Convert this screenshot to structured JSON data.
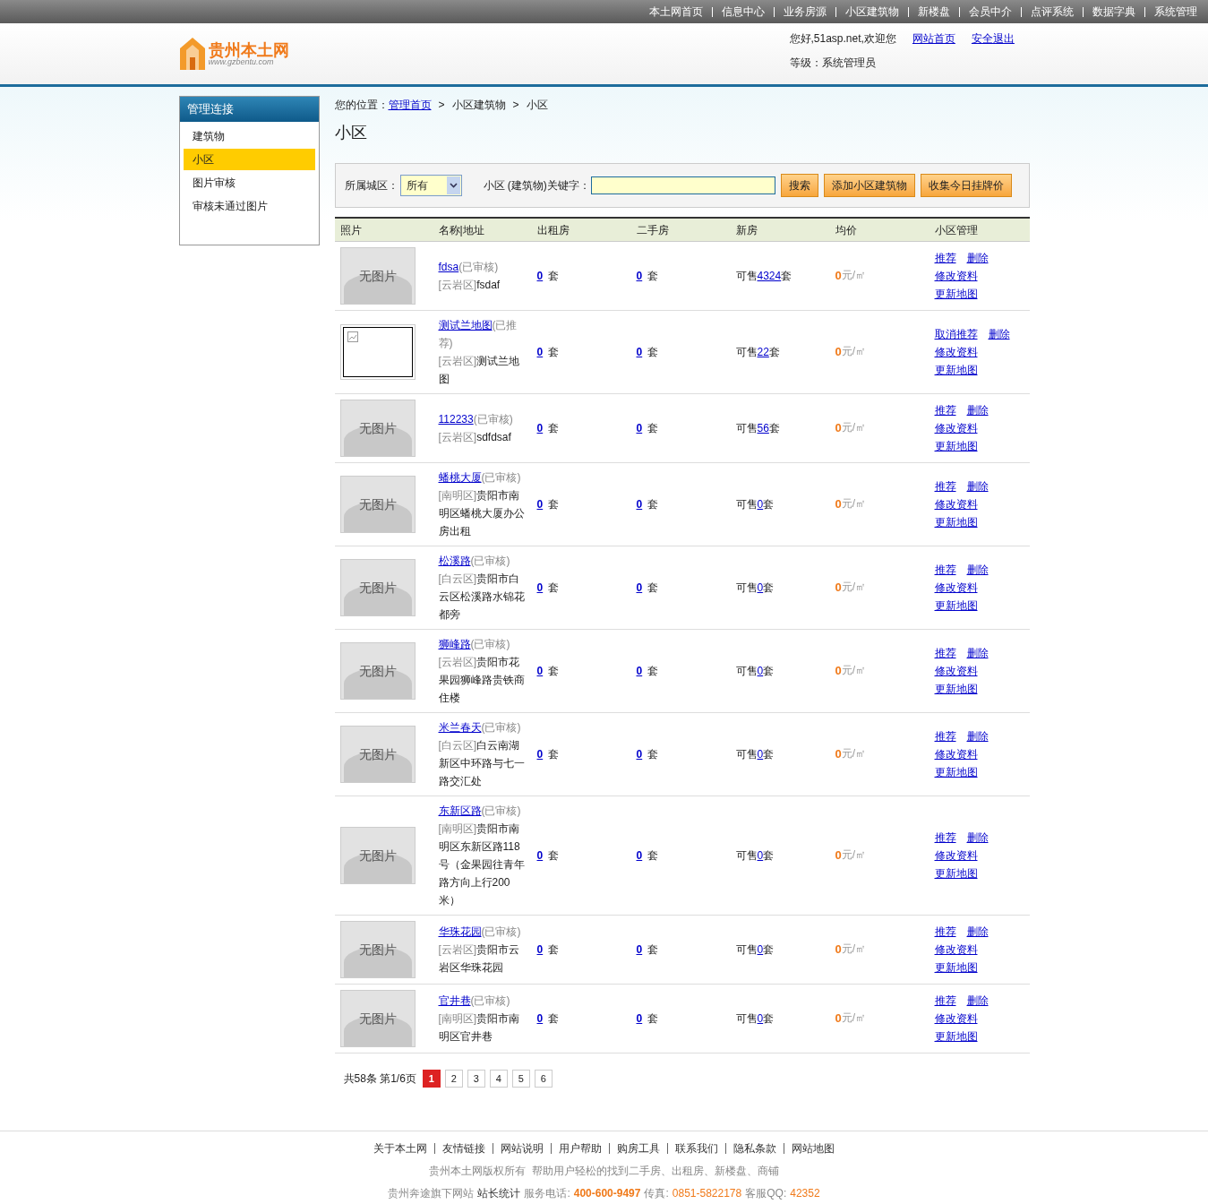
{
  "top_nav": [
    "本土网首页",
    "信息中心",
    "业务房源",
    "小区建筑物",
    "新楼盘",
    "会员中介",
    "点评系统",
    "数据字典",
    "系统管理"
  ],
  "logo": {
    "title": "贵州本土网",
    "url": "www.gzbentu.com"
  },
  "user": {
    "greeting": "您好,51asp.net,欢迎您",
    "links": [
      "网站首页",
      "安全退出"
    ],
    "level": "等级：系统管理员"
  },
  "sidebar": {
    "title": "管理连接",
    "items": [
      {
        "label": "建筑物",
        "selected": false
      },
      {
        "label": "小区",
        "selected": true
      },
      {
        "label": "图片审核",
        "selected": false
      },
      {
        "label": "审核未通过图片",
        "selected": false
      }
    ]
  },
  "breadcrumb": {
    "prefix": "您的位置：",
    "home": "管理首页",
    "sep": ">",
    "items": [
      "小区建筑物",
      "小区"
    ]
  },
  "page_title": "小区",
  "filter": {
    "district_label": "所属城区：",
    "district_value": "所有",
    "keyword_label": "小区 (建筑物)关键字：",
    "buttons": [
      "搜索",
      "添加小区建筑物",
      "收集今日挂牌价"
    ]
  },
  "table": {
    "columns": [
      "照片",
      "名称|地址",
      "出租房",
      "二手房",
      "新房",
      "均价",
      "小区管理"
    ],
    "rows": [
      {
        "photo": {
          "kind": "placeholder",
          "text": "无图片"
        },
        "name": "fdsa",
        "status": "(已审核)",
        "district": "[云岩区]",
        "address": "fsdaf",
        "rent": "0",
        "rent_unit": "套",
        "second": "0",
        "second_unit": "套",
        "sale_prefix": "可售",
        "new": "4324",
        "new_unit": "套",
        "price": "0",
        "price_unit": "元/㎡",
        "actions": [
          [
            "推荐",
            "删除"
          ],
          [
            "修改资料"
          ],
          [
            "更新地图"
          ]
        ]
      },
      {
        "photo": {
          "kind": "broken"
        },
        "name": "测试兰地图",
        "status": "(已推荐)",
        "district": "[云岩区]",
        "address": "测试兰地图",
        "rent": "0",
        "rent_unit": "套",
        "second": "0",
        "second_unit": "套",
        "sale_prefix": "可售",
        "new": "22",
        "new_unit": "套",
        "price": "0",
        "price_unit": "元/㎡",
        "actions": [
          [
            "取消推荐",
            "删除"
          ],
          [
            "修改资料"
          ],
          [
            "更新地图"
          ]
        ]
      },
      {
        "photo": {
          "kind": "placeholder",
          "text": "无图片"
        },
        "name": "112233",
        "status": "(已审核)",
        "district": "[云岩区]",
        "address": "sdfdsaf",
        "rent": "0",
        "rent_unit": "套",
        "second": "0",
        "second_unit": "套",
        "sale_prefix": "可售",
        "new": "56",
        "new_unit": "套",
        "price": "0",
        "price_unit": "元/㎡",
        "actions": [
          [
            "推荐",
            "删除"
          ],
          [
            "修改资料"
          ],
          [
            "更新地图"
          ]
        ]
      },
      {
        "photo": {
          "kind": "placeholder",
          "text": "无图片"
        },
        "name": "蟠桃大厦",
        "status": "(已审核)",
        "district": "[南明区]",
        "address": "贵阳市南明区蟠桃大厦办公房出租",
        "rent": "0",
        "rent_unit": "套",
        "second": "0",
        "second_unit": "套",
        "sale_prefix": "可售",
        "new": "0",
        "new_unit": "套",
        "price": "0",
        "price_unit": "元/㎡",
        "actions": [
          [
            "推荐",
            "删除"
          ],
          [
            "修改资料"
          ],
          [
            "更新地图"
          ]
        ]
      },
      {
        "photo": {
          "kind": "placeholder",
          "text": "无图片"
        },
        "name": "松溪路",
        "status": "(已审核)",
        "district": "[白云区]",
        "address": "贵阳市白云区松溪路水锦花都旁",
        "rent": "0",
        "rent_unit": "套",
        "second": "0",
        "second_unit": "套",
        "sale_prefix": "可售",
        "new": "0",
        "new_unit": "套",
        "price": "0",
        "price_unit": "元/㎡",
        "actions": [
          [
            "推荐",
            "删除"
          ],
          [
            "修改资料"
          ],
          [
            "更新地图"
          ]
        ]
      },
      {
        "photo": {
          "kind": "placeholder",
          "text": "无图片"
        },
        "name": "狮峰路",
        "status": "(已审核)",
        "district": "[云岩区]",
        "address": "贵阳市花果园狮峰路贵铁商住楼",
        "rent": "0",
        "rent_unit": "套",
        "second": "0",
        "second_unit": "套",
        "sale_prefix": "可售",
        "new": "0",
        "new_unit": "套",
        "price": "0",
        "price_unit": "元/㎡",
        "actions": [
          [
            "推荐",
            "删除"
          ],
          [
            "修改资料"
          ],
          [
            "更新地图"
          ]
        ]
      },
      {
        "photo": {
          "kind": "placeholder",
          "text": "无图片"
        },
        "name": "米兰春天",
        "status": "(已审核)",
        "district": "[白云区]",
        "address": "白云南湖新区中环路与七一路交汇处",
        "rent": "0",
        "rent_unit": "套",
        "second": "0",
        "second_unit": "套",
        "sale_prefix": "可售",
        "new": "0",
        "new_unit": "套",
        "price": "0",
        "price_unit": "元/㎡",
        "actions": [
          [
            "推荐",
            "删除"
          ],
          [
            "修改资料"
          ],
          [
            "更新地图"
          ]
        ]
      },
      {
        "photo": {
          "kind": "placeholder",
          "text": "无图片"
        },
        "name": "东新区路",
        "status": "(已审核)",
        "district": "[南明区]",
        "address": "贵阳市南明区东新区路118号（金果园往青年路方向上行200米）",
        "rent": "0",
        "rent_unit": "套",
        "second": "0",
        "second_unit": "套",
        "sale_prefix": "可售",
        "new": "0",
        "new_unit": "套",
        "price": "0",
        "price_unit": "元/㎡",
        "actions": [
          [
            "推荐",
            "删除"
          ],
          [
            "修改资料"
          ],
          [
            "更新地图"
          ]
        ]
      },
      {
        "photo": {
          "kind": "placeholder",
          "text": "无图片"
        },
        "name": "华珠花园",
        "status": "(已审核)",
        "district": "[云岩区]",
        "address": "贵阳市云岩区华珠花园",
        "rent": "0",
        "rent_unit": "套",
        "second": "0",
        "second_unit": "套",
        "sale_prefix": "可售",
        "new": "0",
        "new_unit": "套",
        "price": "0",
        "price_unit": "元/㎡",
        "actions": [
          [
            "推荐",
            "删除"
          ],
          [
            "修改资料"
          ],
          [
            "更新地图"
          ]
        ]
      },
      {
        "photo": {
          "kind": "placeholder",
          "text": "无图片"
        },
        "name": "官井巷",
        "status": "(已审核)",
        "district": "[南明区]",
        "address": "贵阳市南明区官井巷",
        "rent": "0",
        "rent_unit": "套",
        "second": "0",
        "second_unit": "套",
        "sale_prefix": "可售",
        "new": "0",
        "new_unit": "套",
        "price": "0",
        "price_unit": "元/㎡",
        "actions": [
          [
            "推荐",
            "删除"
          ],
          [
            "修改资料"
          ],
          [
            "更新地图"
          ]
        ]
      }
    ]
  },
  "pagination": {
    "summary": "共58条 第1/6页",
    "pages": [
      {
        "label": "1",
        "selected": true
      },
      {
        "label": "2",
        "selected": false
      },
      {
        "label": "3",
        "selected": false
      },
      {
        "label": "4",
        "selected": false
      },
      {
        "label": "5",
        "selected": false
      },
      {
        "label": "6",
        "selected": false
      }
    ]
  },
  "footer": {
    "links": [
      "关于本土网",
      "友情链接",
      "网站说明",
      "用户帮助",
      "购房工具",
      "联系我们",
      "隐私条款",
      "网站地图"
    ],
    "tagline": "贵州本土网版权所有  帮助用户轻松的找到二手房、出租房、新楼盘、商铺",
    "contact": [
      {
        "text": "贵州奔途旗下网站",
        "kind": "plain"
      },
      {
        "text": "站长统计",
        "kind": "dark"
      },
      {
        "text": "服务电话:",
        "kind": "plain"
      },
      {
        "text": "400-600-9497",
        "kind": "strong"
      },
      {
        "text": "传真:",
        "kind": "plain"
      },
      {
        "text": "0851-5822178",
        "kind": "accent"
      },
      {
        "text": "客服QQ:",
        "kind": "plain"
      },
      {
        "text": "42352",
        "kind": "accent"
      }
    ]
  }
}
